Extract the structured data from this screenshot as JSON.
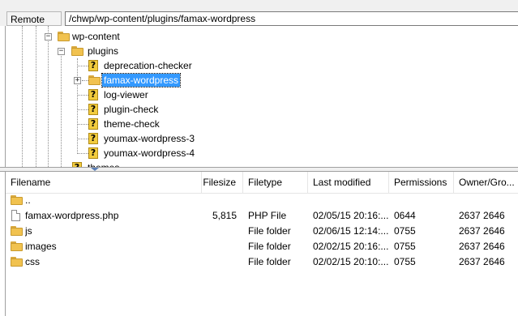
{
  "remote_site": {
    "label": "Remote site:",
    "path": "/chwp/wp-content/plugins/famax-wordpress"
  },
  "tree": {
    "wp_content": "wp-content",
    "plugins": "plugins",
    "children": [
      {
        "label": "deprecation-checker",
        "icon": "question-folder-icon"
      },
      {
        "label": "famax-wordpress",
        "icon": "folder-icon",
        "selected": true
      },
      {
        "label": "log-viewer",
        "icon": "question-folder-icon"
      },
      {
        "label": "plugin-check",
        "icon": "question-folder-icon"
      },
      {
        "label": "theme-check",
        "icon": "question-folder-icon"
      },
      {
        "label": "youmax-wordpress-3",
        "icon": "question-folder-icon"
      },
      {
        "label": "youmax-wordpress-4",
        "icon": "question-folder-icon"
      }
    ],
    "themes": "themes",
    "selected_color": "#3399ff"
  },
  "file_list": {
    "columns": [
      "Filename",
      "Filesize",
      "Filetype",
      "Last modified",
      "Permissions",
      "Owner/Gro..."
    ],
    "rows": [
      {
        "name": "..",
        "size": "",
        "type": "",
        "modified": "",
        "perms": "",
        "owner": "",
        "icon": "folder-icon"
      },
      {
        "name": "famax-wordpress.php",
        "size": "5,815",
        "type": "PHP File",
        "modified": "02/05/15 20:16:...",
        "perms": "0644",
        "owner": "2637 2646",
        "icon": "file-icon"
      },
      {
        "name": "js",
        "size": "",
        "type": "File folder",
        "modified": "02/06/15 12:14:...",
        "perms": "0755",
        "owner": "2637 2646",
        "icon": "folder-icon"
      },
      {
        "name": "images",
        "size": "",
        "type": "File folder",
        "modified": "02/02/15 20:16:...",
        "perms": "0755",
        "owner": "2637 2646",
        "icon": "folder-icon"
      },
      {
        "name": "css",
        "size": "",
        "type": "File folder",
        "modified": "02/02/15 20:10:...",
        "perms": "0755",
        "owner": "2637 2646",
        "icon": "folder-icon"
      }
    ]
  }
}
